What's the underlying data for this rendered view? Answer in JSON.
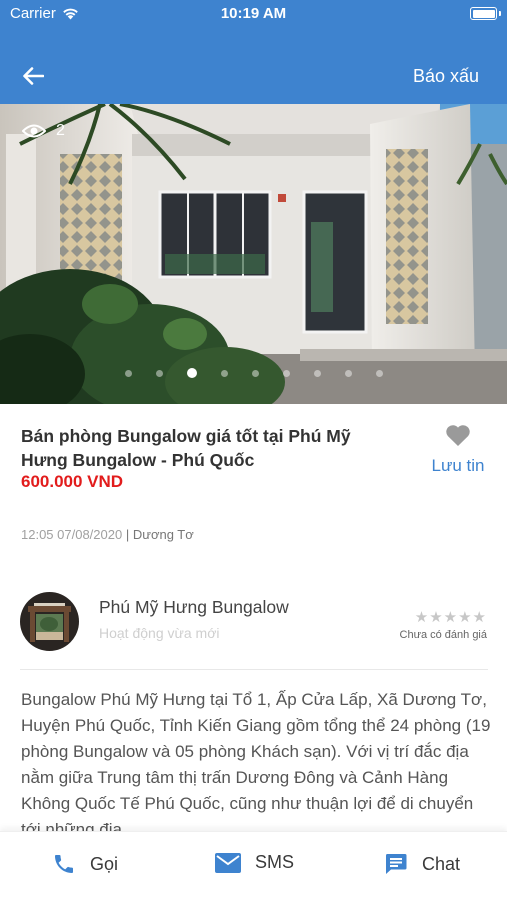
{
  "status_bar": {
    "carrier": "Carrier",
    "time": "10:19 AM"
  },
  "nav": {
    "back_icon": "arrow-left-icon",
    "report_label": "Báo xấu"
  },
  "gallery": {
    "view_count": "2",
    "dot_count": 9,
    "active_index": 2
  },
  "listing": {
    "title": "Bán phòng Bungalow giá tốt tại Phú Mỹ Hưng Bungalow - Phú Quốc",
    "price": "600.000 VND",
    "save_label": "Lưu tin",
    "posted_time": "12:05 07/08/2020",
    "separator": "|",
    "posted_by": "Dương Tơ"
  },
  "seller": {
    "name": "Phú Mỹ Hưng Bungalow",
    "status": "Hoạt động vừa mới",
    "rating_stars": "★★★★★",
    "rating_label": "Chưa có đánh giá"
  },
  "description": "Bungalow Phú Mỹ Hưng tại Tổ 1, Ấp Cửa Lấp, Xã Dương Tơ, Huyện Phú Quốc, Tỉnh Kiến Giang gồm tổng thể 24 phòng (19 phòng Bungalow và 05 phòng Khách sạn). Với vị trí đắc địa nằm giữa Trung tâm thị trấn Dương Đông và Cảnh Hàng Không Quốc Tế Phú Quốc, cũng như thuận lợi để di chuyển tới những địa",
  "actions": {
    "call_label": "Gọi",
    "sms_label": "SMS",
    "chat_label": "Chat"
  },
  "colors": {
    "header": "#3e83cf",
    "price": "#e21c1c",
    "accent": "#3e83cf"
  }
}
